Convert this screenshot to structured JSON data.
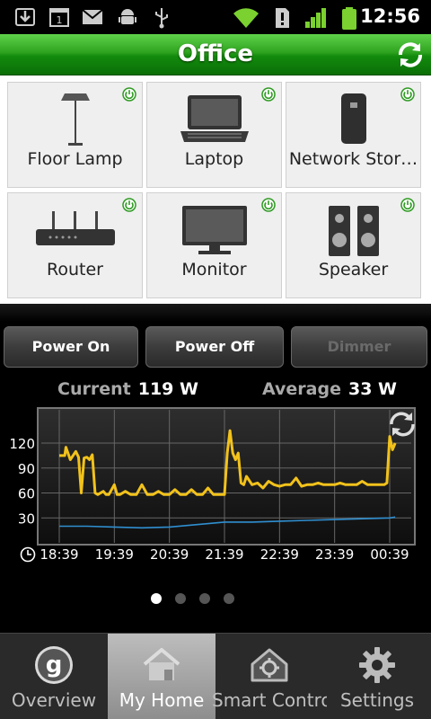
{
  "status_bar": {
    "time": "12:56",
    "calendar_day": "1",
    "icons": [
      "download-icon",
      "calendar-icon",
      "gmail-icon",
      "android-debug-icon",
      "usb-icon",
      "wifi-icon",
      "alert-icon",
      "signal-icon",
      "battery-icon"
    ]
  },
  "header": {
    "title": "Office",
    "accent_color": "#2ea31f"
  },
  "devices": [
    {
      "label": "Floor Lamp",
      "icon": "floor-lamp-icon",
      "power": "on"
    },
    {
      "label": "Laptop",
      "icon": "laptop-icon",
      "power": "on"
    },
    {
      "label": "Network Stor…",
      "icon": "network-storage-icon",
      "power": "on"
    },
    {
      "label": "Router",
      "icon": "router-icon",
      "power": "on"
    },
    {
      "label": "Monitor",
      "icon": "monitor-icon",
      "power": "on"
    },
    {
      "label": "Speaker",
      "icon": "speaker-icon",
      "power": "on"
    }
  ],
  "controls": {
    "power_on": "Power On",
    "power_off": "Power Off",
    "dimmer": "Dimmer"
  },
  "readouts": {
    "current_label": "Current",
    "current_value": "119 W",
    "average_label": "Average",
    "average_value": "33 W"
  },
  "chart_data": {
    "type": "line",
    "x_ticks": [
      "18:39",
      "19:39",
      "20:39",
      "21:39",
      "22:39",
      "23:39",
      "00:39"
    ],
    "y_ticks": [
      120,
      90,
      60,
      30
    ],
    "ylim": [
      0,
      160
    ],
    "grid": true,
    "series": [
      {
        "color": "#f2c21b",
        "x": [
          0,
          0.1,
          0.12,
          0.2,
          0.3,
          0.35,
          0.4,
          0.45,
          0.5,
          0.55,
          0.6,
          0.65,
          0.7,
          0.8,
          0.85,
          0.9,
          1.0,
          1.05,
          1.1,
          1.2,
          1.3,
          1.4,
          1.5,
          1.6,
          1.7,
          1.8,
          1.9,
          2.0,
          2.1,
          2.2,
          2.3,
          2.4,
          2.5,
          2.6,
          2.7,
          2.8,
          2.9,
          3.0,
          3.05,
          3.1,
          3.15,
          3.2,
          3.25,
          3.3,
          3.35,
          3.4,
          3.5,
          3.6,
          3.7,
          3.8,
          3.9,
          4.0,
          4.1,
          4.2,
          4.3,
          4.4,
          4.5,
          4.6,
          4.7,
          4.8,
          4.9,
          5.0,
          5.1,
          5.2,
          5.3,
          5.4,
          5.5,
          5.6,
          5.7,
          5.8,
          5.9,
          5.95,
          6.0,
          6.05,
          6.1
        ],
        "y": [
          105,
          105,
          115,
          100,
          110,
          103,
          60,
          102,
          103,
          100,
          106,
          60,
          58,
          62,
          58,
          58,
          70,
          58,
          58,
          62,
          58,
          58,
          70,
          58,
          58,
          62,
          58,
          58,
          64,
          58,
          58,
          64,
          58,
          58,
          66,
          58,
          58,
          58,
          108,
          135,
          108,
          100,
          108,
          72,
          70,
          80,
          70,
          72,
          66,
          74,
          70,
          68,
          70,
          70,
          78,
          68,
          70,
          70,
          72,
          70,
          70,
          70,
          72,
          70,
          70,
          70,
          74,
          70,
          70,
          70,
          70,
          72,
          128,
          112,
          120
        ],
        "name": ""
      },
      {
        "color": "#2f8fd0",
        "x": [
          0,
          0.5,
          1,
          1.5,
          2,
          2.5,
          3,
          3.5,
          4,
          4.5,
          5,
          5.5,
          6,
          6.1
        ],
        "y": [
          20,
          20,
          19,
          18,
          19,
          22,
          25,
          25,
          26,
          27,
          28,
          29,
          30,
          31
        ],
        "name": ""
      }
    ]
  },
  "pager": {
    "count": 4,
    "active": 0
  },
  "tabs": [
    {
      "label": "Overview",
      "icon": "g-logo-icon"
    },
    {
      "label": "My Home",
      "icon": "home-icon"
    },
    {
      "label": "Smart Contro",
      "icon": "smart-control-icon"
    },
    {
      "label": "Settings",
      "icon": "gear-icon"
    }
  ],
  "active_tab": 1
}
